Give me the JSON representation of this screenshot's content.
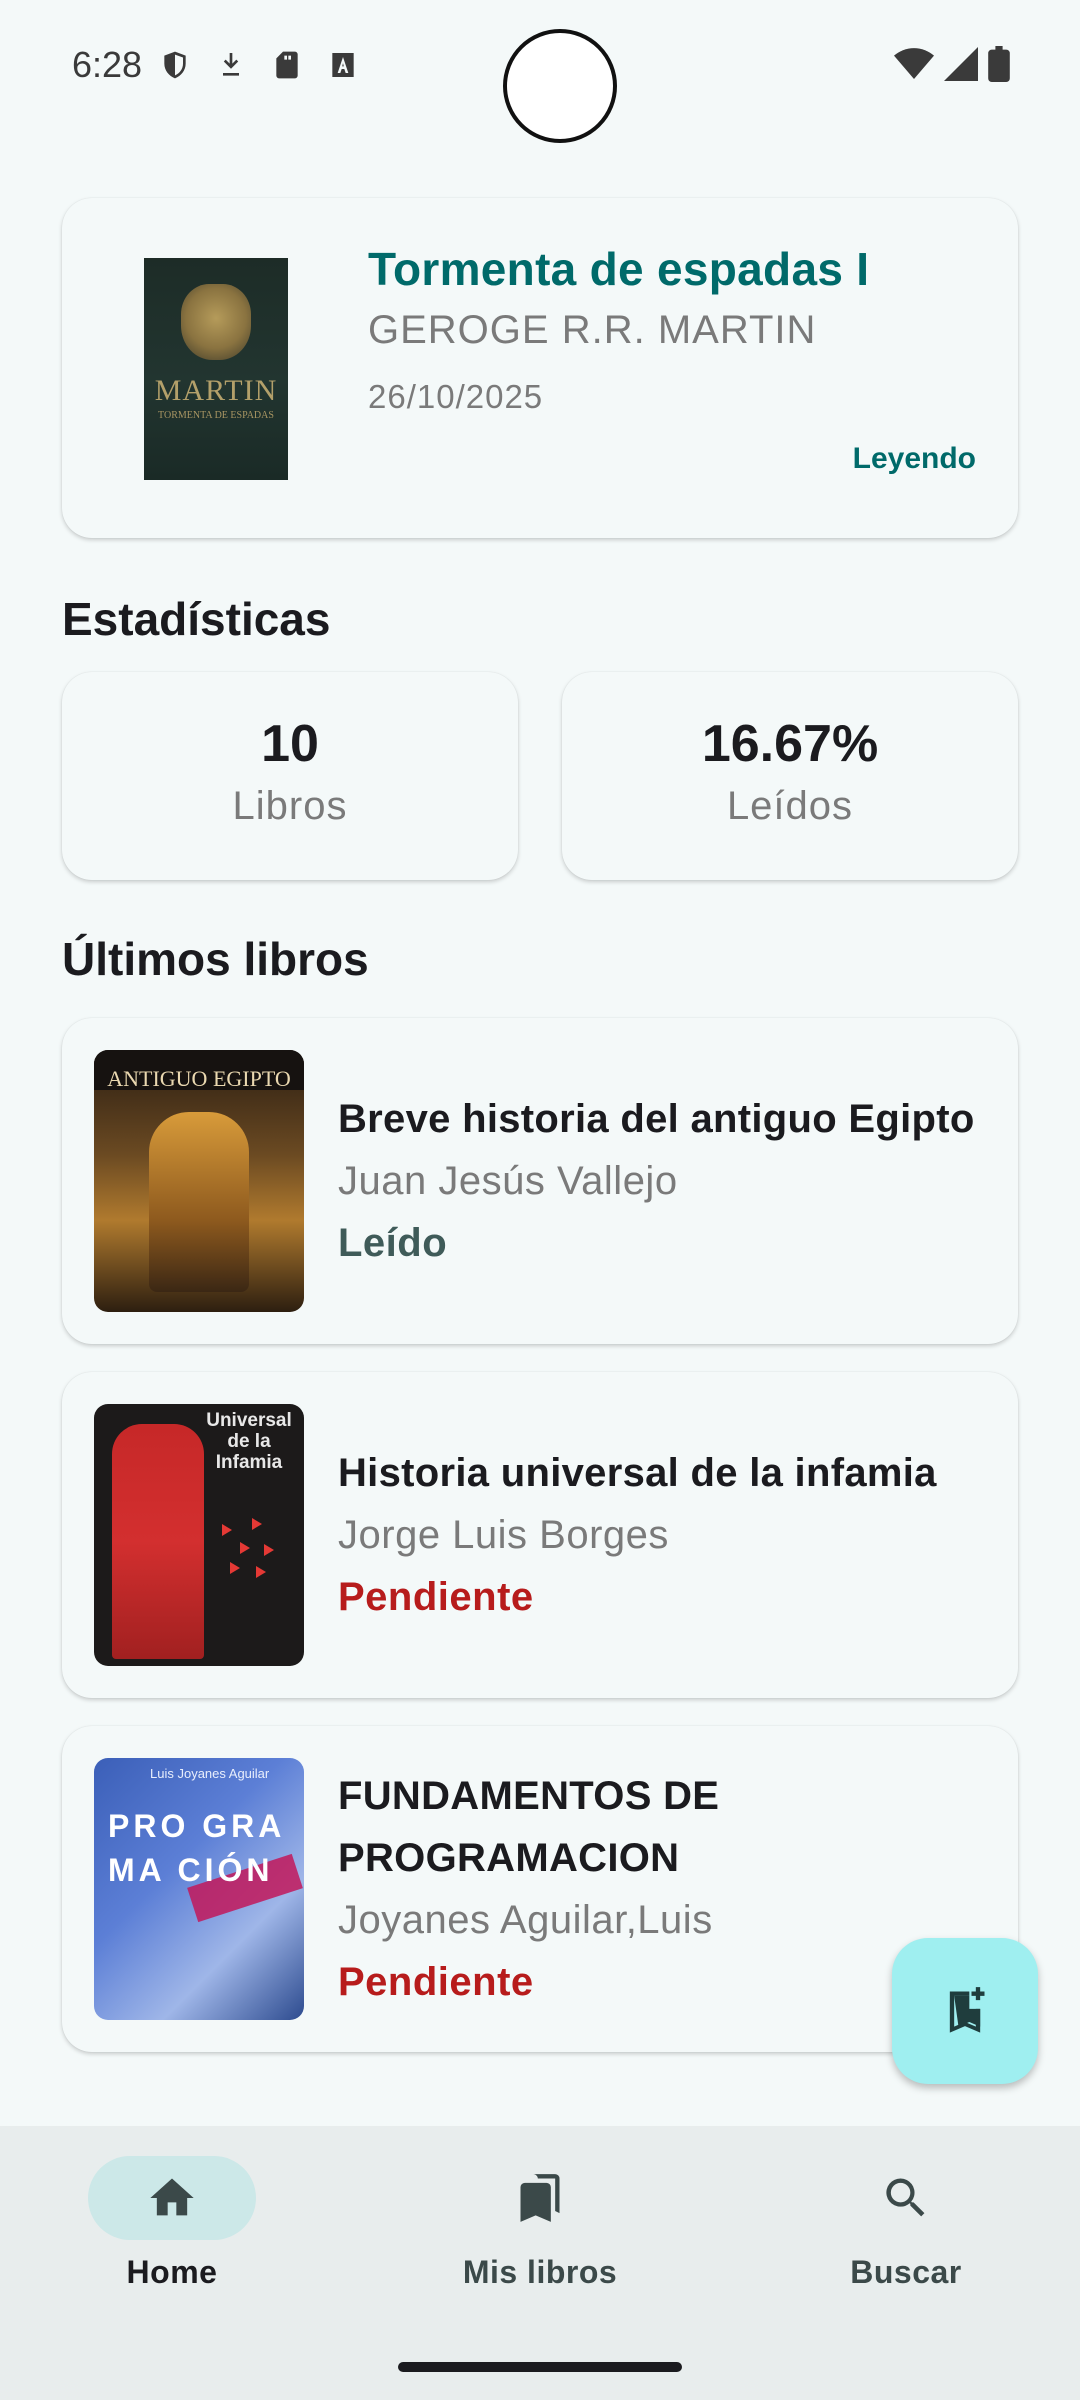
{
  "status_bar": {
    "time": "6:28",
    "icons": [
      "shield-icon",
      "download-icon",
      "sd-card-icon",
      "a-icon",
      "wifi-icon",
      "cell-signal-icon",
      "battery-icon"
    ]
  },
  "featured": {
    "title": "Tormenta de espadas I",
    "author": "GEROGE R.R. MARTIN",
    "date": "26/10/2025",
    "status": "Leyendo",
    "cover": {
      "author_text": "MARTIN",
      "subtitle": "TORMENTA DE ESPADAS"
    }
  },
  "stats": {
    "heading": "Estadísticas",
    "books_value": "10",
    "books_label": "Libros",
    "read_value": "16.67%",
    "read_label": "Leídos"
  },
  "recent": {
    "heading": "Últimos libros",
    "books": [
      {
        "title": "Breve historia del antiguo Egipto",
        "author": "Juan Jesús Vallejo",
        "status": "Leído",
        "cover_text": "ANTIGUO EGIPTO"
      },
      {
        "title": "Historia universal de la infamia",
        "author": "Jorge Luis Borges",
        "status": "Pendiente",
        "cover_text": "Universal de la Infamia"
      },
      {
        "title": "FUNDAMENTOS DE PROGRAMACION",
        "author": "Joyanes Aguilar,Luis",
        "status": "Pendiente",
        "cover_text": "PRO GRA MA CIÓN",
        "cover_author": "Luis Joyanes Aguilar"
      }
    ]
  },
  "fab": {
    "icon": "bookmark-add-icon"
  },
  "nav": {
    "home": "Home",
    "my_books": "Mis libros",
    "search": "Buscar",
    "active": "home"
  },
  "colors": {
    "accent": "#006a6a",
    "pending": "#b71c1c",
    "read": "#3f5b59",
    "fab": "#9feff0",
    "nav_active": "#cce8e8"
  }
}
